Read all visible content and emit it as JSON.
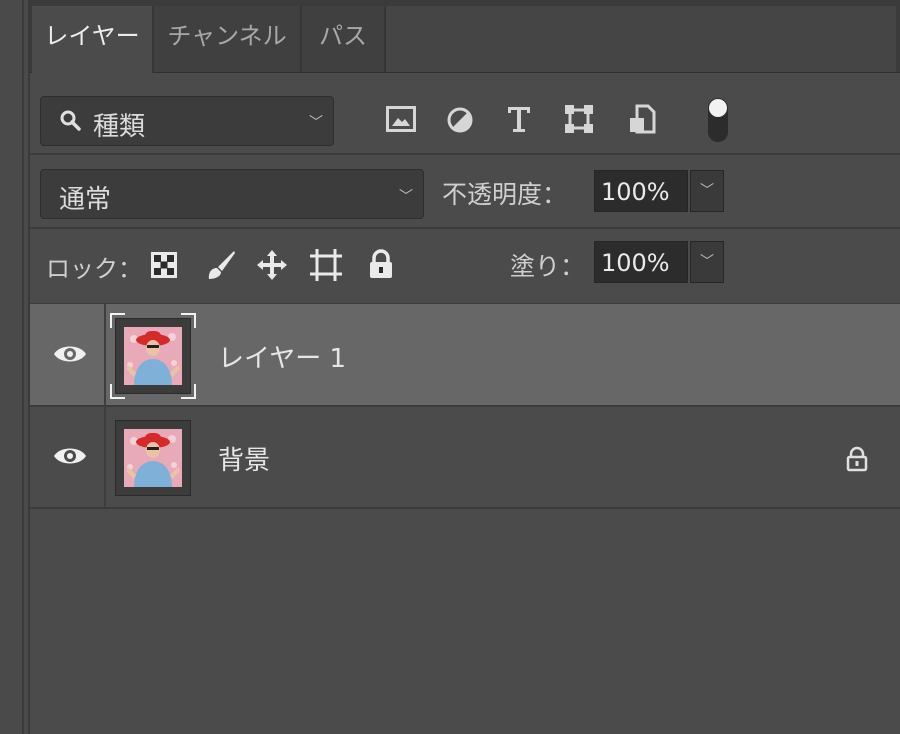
{
  "tabs": [
    {
      "label": "レイヤー",
      "active": true
    },
    {
      "label": "チャンネル",
      "active": false
    },
    {
      "label": "パス",
      "active": false
    }
  ],
  "filter": {
    "kind_label": "種類",
    "icons": [
      "image-filter-icon",
      "adjustment-filter-icon",
      "type-filter-icon",
      "shape-filter-icon",
      "smart-object-filter-icon",
      "filter-toggle-icon"
    ]
  },
  "blend": {
    "mode": "通常",
    "opacity_label": "不透明度：",
    "opacity_value": "100%"
  },
  "lock": {
    "label": "ロック：",
    "icons": [
      "lock-transparent-pixels-icon",
      "lock-image-pixels-icon",
      "lock-position-icon",
      "lock-artboard-icon",
      "lock-all-icon"
    ],
    "fill_label": "塗り：",
    "fill_value": "100%"
  },
  "layers": [
    {
      "name": "レイヤー 1",
      "selected": true,
      "visible": true,
      "locked": false
    },
    {
      "name": "背景",
      "selected": false,
      "visible": true,
      "locked": true
    }
  ],
  "colors": {
    "panel": "#4b4b4b",
    "selected_row": "#676767",
    "text": "#e6e6e6"
  }
}
